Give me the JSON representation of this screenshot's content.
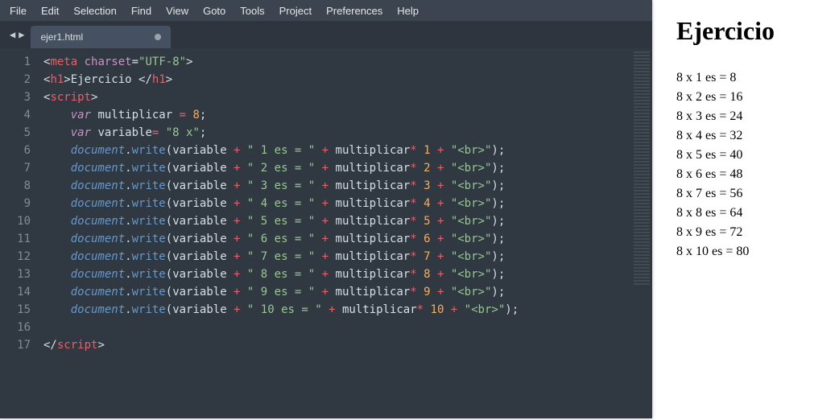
{
  "menu": [
    "File",
    "Edit",
    "Selection",
    "Find",
    "View",
    "Goto",
    "Tools",
    "Project",
    "Preferences",
    "Help"
  ],
  "tab": {
    "title": "ejer1.html",
    "dirty": true
  },
  "gutter": [
    "1",
    "2",
    "3",
    "4",
    "5",
    "6",
    "7",
    "8",
    "9",
    "10",
    "11",
    "12",
    "13",
    "14",
    "15",
    "16",
    "17"
  ],
  "highlighted_line_index": 13,
  "code": {
    "l1": {
      "open": "<",
      "tag": "meta",
      "sp": " ",
      "attr": "charset",
      "eq": "=",
      "val": "\"UTF-8\"",
      "close": ">"
    },
    "l2": {
      "open": "<",
      "tag": "h1",
      "gt": ">",
      "text": "Ejercicio ",
      "open2": "</",
      "tag2": "h1",
      "gt2": ">"
    },
    "l3": {
      "open": "<",
      "tag": "script",
      "gt": ">"
    },
    "l4": {
      "kw": "var",
      "sp": " ",
      "id": "multiplicar",
      "sp2": " ",
      "eq": "=",
      "sp3": " ",
      "num": "8",
      "semi": ";"
    },
    "l5": {
      "kw": "var",
      "sp": " ",
      "id": "variable",
      "eq": "= ",
      "str": "\"8 x\"",
      "semi": ";"
    },
    "dw": {
      "obj": "document",
      "dot": ".",
      "fn": "write",
      "lp": "(",
      "var": "variable",
      "plus": " + ",
      "esA": "\" ",
      "es": " es = \"",
      "plus2": " + ",
      "mid": "multiplicar",
      "star": "* ",
      "plus3": " + ",
      "br": "\"<br>\"",
      "rp": ")",
      "semi": ";"
    },
    "nums": [
      "1",
      "2",
      "3",
      "4",
      "5",
      "6",
      "7",
      "8",
      "9",
      "10"
    ],
    "l17": {
      "open": "</",
      "tag": "script",
      "gt": ">"
    }
  },
  "output": {
    "heading": "Ejercicio",
    "rows": [
      "8 x 1 es = 8",
      "8 x 2 es = 16",
      "8 x 3 es = 24",
      "8 x 4 es = 32",
      "8 x 5 es = 40",
      "8 x 6 es = 48",
      "8 x 7 es = 56",
      "8 x 8 es = 64",
      "8 x 9 es = 72",
      "8 x 10 es = 80"
    ]
  }
}
